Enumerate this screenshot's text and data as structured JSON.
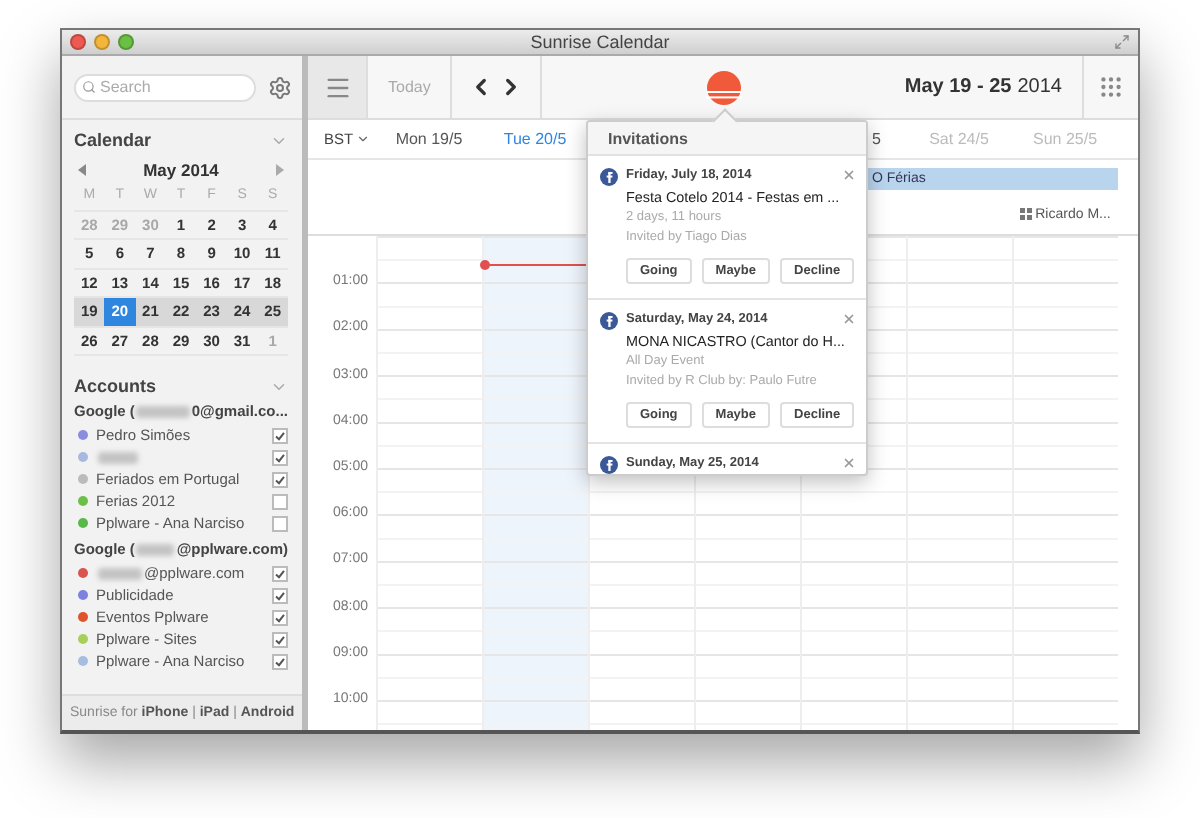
{
  "window": {
    "title": "Sunrise Calendar"
  },
  "sidebar": {
    "search": {
      "placeholder": "Search"
    },
    "calendar_section": {
      "title": "Calendar",
      "month": "May 2014",
      "weekdays": [
        "M",
        "T",
        "W",
        "T",
        "F",
        "S",
        "S"
      ],
      "weeks": [
        {
          "selected": false,
          "days": [
            {
              "label": "28",
              "muted": true,
              "selected": false
            },
            {
              "label": "29",
              "muted": true,
              "selected": false
            },
            {
              "label": "30",
              "muted": true,
              "selected": false
            },
            {
              "label": "1",
              "muted": false,
              "selected": false
            },
            {
              "label": "2",
              "muted": false,
              "selected": false
            },
            {
              "label": "3",
              "muted": false,
              "selected": false
            },
            {
              "label": "4",
              "muted": false,
              "selected": false
            }
          ]
        },
        {
          "selected": false,
          "days": [
            {
              "label": "5",
              "muted": false,
              "selected": false
            },
            {
              "label": "6",
              "muted": false,
              "selected": false
            },
            {
              "label": "7",
              "muted": false,
              "selected": false
            },
            {
              "label": "8",
              "muted": false,
              "selected": false
            },
            {
              "label": "9",
              "muted": false,
              "selected": false
            },
            {
              "label": "10",
              "muted": false,
              "selected": false
            },
            {
              "label": "11",
              "muted": false,
              "selected": false
            }
          ]
        },
        {
          "selected": false,
          "days": [
            {
              "label": "12",
              "muted": false,
              "selected": false
            },
            {
              "label": "13",
              "muted": false,
              "selected": false
            },
            {
              "label": "14",
              "muted": false,
              "selected": false
            },
            {
              "label": "15",
              "muted": false,
              "selected": false
            },
            {
              "label": "16",
              "muted": false,
              "selected": false
            },
            {
              "label": "17",
              "muted": false,
              "selected": false
            },
            {
              "label": "18",
              "muted": false,
              "selected": false
            }
          ]
        },
        {
          "selected": true,
          "days": [
            {
              "label": "19",
              "muted": false,
              "selected": false
            },
            {
              "label": "20",
              "muted": false,
              "selected": true
            },
            {
              "label": "21",
              "muted": false,
              "selected": false
            },
            {
              "label": "22",
              "muted": false,
              "selected": false
            },
            {
              "label": "23",
              "muted": false,
              "selected": false
            },
            {
              "label": "24",
              "muted": false,
              "selected": false
            },
            {
              "label": "25",
              "muted": false,
              "selected": false
            }
          ]
        },
        {
          "selected": false,
          "days": [
            {
              "label": "26",
              "muted": false,
              "selected": false
            },
            {
              "label": "27",
              "muted": false,
              "selected": false
            },
            {
              "label": "28",
              "muted": false,
              "selected": false
            },
            {
              "label": "29",
              "muted": false,
              "selected": false
            },
            {
              "label": "30",
              "muted": false,
              "selected": false
            },
            {
              "label": "31",
              "muted": false,
              "selected": false
            },
            {
              "label": "1",
              "muted": true,
              "selected": false
            }
          ]
        }
      ]
    },
    "accounts_section": {
      "title": "Accounts",
      "accounts": [
        {
          "prefix": "Google (",
          "suffix": "0@gmail.co...",
          "calendars": [
            {
              "name": "Pedro Simões",
              "redacted": false,
              "color": "#8a8ce0",
              "checked": true
            },
            {
              "redacted": true,
              "color": "#a9b8e0",
              "checked": true
            },
            {
              "name": "Feriados em Portugal",
              "redacted": false,
              "color": "#bbbbbb",
              "checked": true
            },
            {
              "name": "Ferias 2012",
              "redacted": false,
              "color": "#6cc04a",
              "checked": false
            },
            {
              "name": "Pplware - Ana Narciso",
              "redacted": false,
              "color": "#58b848",
              "checked": false
            }
          ]
        },
        {
          "prefix": "Google (",
          "suffix": "@pplware.com)",
          "calendars": [
            {
              "name": "@pplware.com",
              "redacted": true,
              "color": "#d9534f",
              "checked": true
            },
            {
              "name": "Publicidade",
              "redacted": false,
              "color": "#7b82e0",
              "checked": true
            },
            {
              "name": "Eventos Pplware",
              "redacted": false,
              "color": "#e0522c",
              "checked": true
            },
            {
              "name": "Pplware - Sites",
              "redacted": false,
              "color": "#a7d05a",
              "checked": true
            },
            {
              "name": "Pplware - Ana Narciso",
              "redacted": false,
              "color": "#a7bde0",
              "checked": true
            }
          ]
        }
      ]
    },
    "footer": "Sunrise for **iPhone** | **iPad** | **Android**"
  },
  "toolbar": {
    "today": "Today",
    "range": "May 19 - 25",
    "year": "2014"
  },
  "week_view": {
    "timezone": "BST",
    "days": [
      {
        "label": "Mon 19/5",
        "selected": false,
        "weekend": false,
        "cut": false
      },
      {
        "label": "Tue 20/5",
        "selected": true,
        "weekend": false,
        "cut": false
      },
      {
        "selected": false
      },
      {
        "selected": false
      },
      {
        "label": "5",
        "selected": false,
        "weekend": false,
        "cut": true,
        "events": [
          {
            "title": "O Férias",
            "kind": "multiday"
          }
        ]
      },
      {
        "label": "Sat 24/5",
        "selected": false,
        "weekend": true,
        "cut": false
      },
      {
        "label": "Sun 25/5",
        "selected": false,
        "weekend": true,
        "cut": false,
        "events": [
          {
            "title": "Ricardo M...",
            "kind": "single"
          }
        ]
      }
    ],
    "hours": [
      "01:00",
      "02:00",
      "03:00",
      "04:00",
      "05:00",
      "06:00",
      "07:00",
      "08:00",
      "09:00",
      "10:00"
    ]
  },
  "invitations": {
    "title": "Invitations",
    "items": [
      {
        "date": "Friday, July 18, 2014",
        "title": "Festa Cotelo 2014 - Festas em ...",
        "detail": "2 days, 11 hours",
        "invited_by": "Invited by Tiago Dias",
        "buttons": [
          "Going",
          "Maybe",
          "Decline"
        ]
      },
      {
        "date": "Saturday, May 24, 2014",
        "title": "MONA NICASTRO (Cantor do H...",
        "detail": "All Day Event",
        "invited_by": "Invited by R Club by: Paulo Futre",
        "buttons": [
          "Going",
          "Maybe",
          "Decline"
        ]
      },
      {
        "date": "Sunday, May 25, 2014"
      }
    ]
  }
}
